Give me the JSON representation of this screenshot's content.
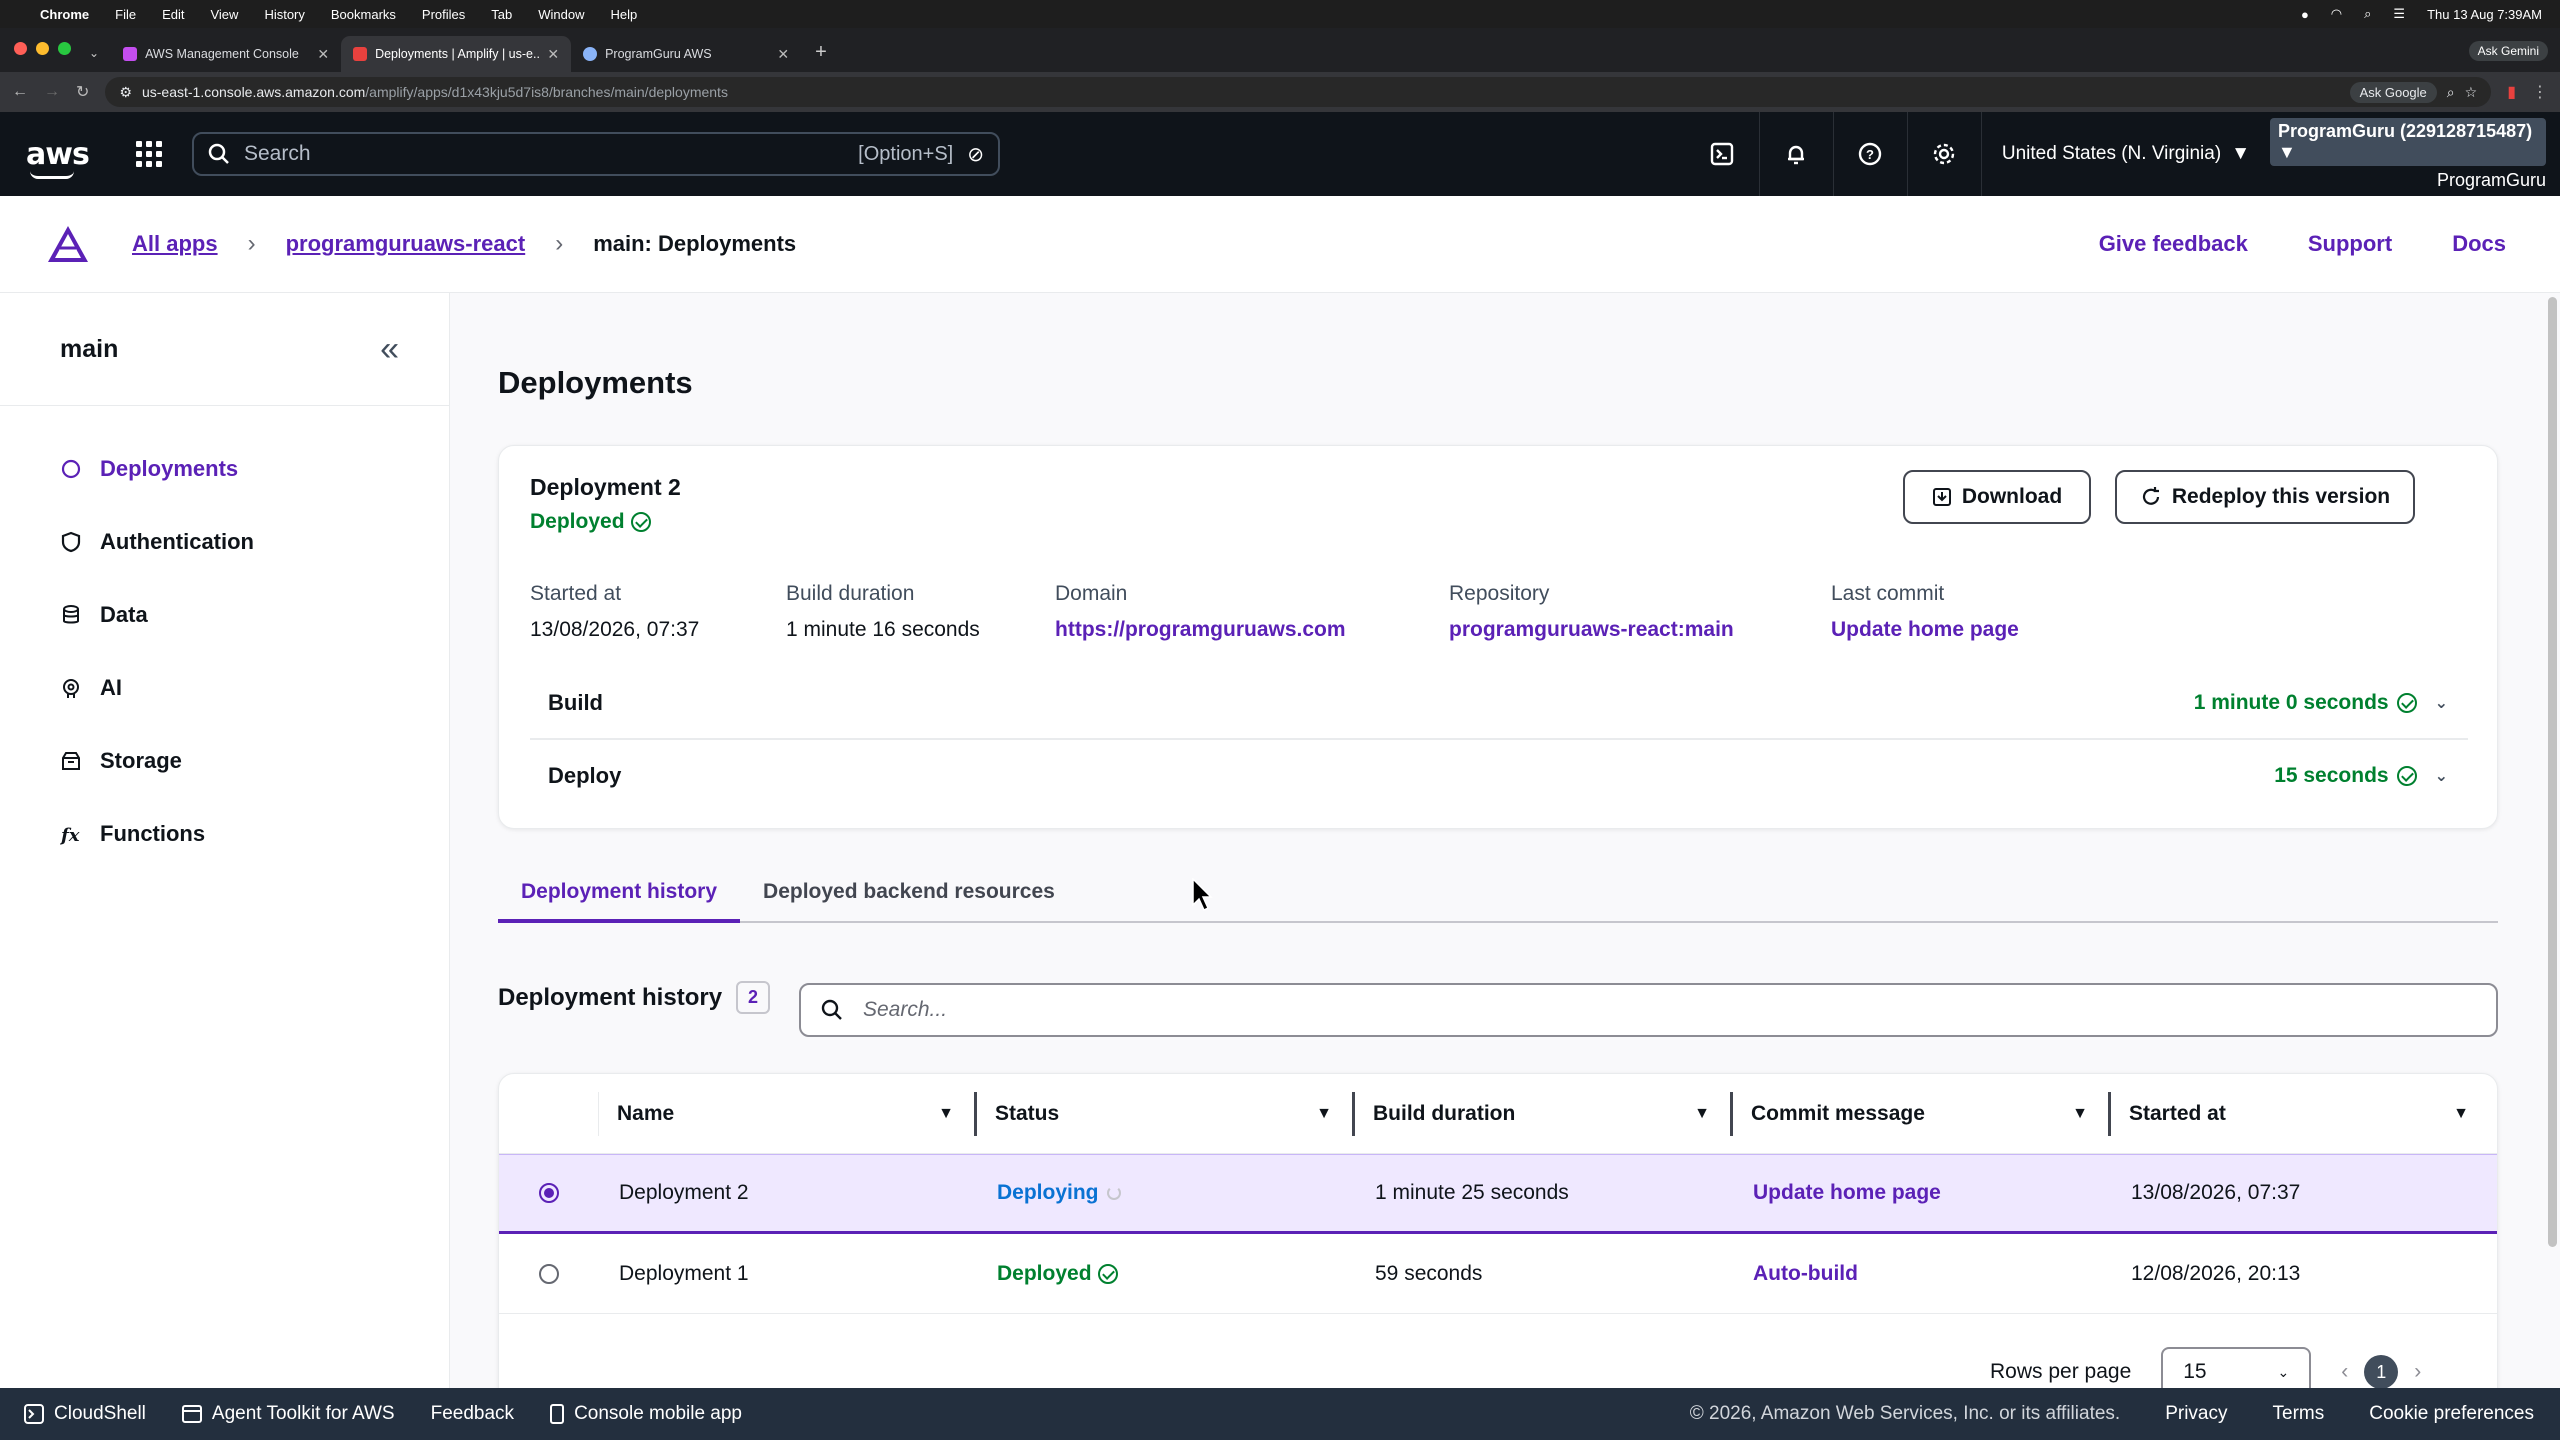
{
  "mac": {
    "app": "Chrome",
    "menus": [
      "File",
      "Edit",
      "View",
      "History",
      "Bookmarks",
      "Profiles",
      "Tab",
      "Window",
      "Help"
    ],
    "datetime": "Thu 13 Aug 7:39AM",
    "ask_gemini": "Ask Gemini"
  },
  "browser": {
    "tabs": [
      {
        "title": "AWS Management Console",
        "active": false
      },
      {
        "title": "Deployments | Amplify | us-e...",
        "active": true
      },
      {
        "title": "ProgramGuru AWS",
        "active": false
      }
    ],
    "url": "us-east-1.console.aws.amazon.com",
    "url_path": "/amplify/apps/d1x43kju5d7is8/branches/main/deployments",
    "ask_google": "Ask Google"
  },
  "awsnav": {
    "logo": "aws",
    "search_placeholder": "Search",
    "search_shortcut": "[Option+S]",
    "region": "United States (N. Virginia)",
    "account": "ProgramGuru (229128715487)",
    "user": "ProgramGuru"
  },
  "amplify": {
    "breadcrumbs": [
      "All apps",
      "programguruaws-react",
      "main: Deployments"
    ],
    "header_links": [
      "Give feedback",
      "Support",
      "Docs"
    ]
  },
  "sidebar": {
    "title": "main",
    "items": [
      {
        "label": "Deployments",
        "icon": "circle-icon",
        "active": true
      },
      {
        "label": "Authentication",
        "icon": "shield-icon",
        "active": false
      },
      {
        "label": "Data",
        "icon": "database-icon",
        "active": false
      },
      {
        "label": "AI",
        "icon": "brain-icon",
        "active": false
      },
      {
        "label": "Storage",
        "icon": "storage-icon",
        "active": false
      },
      {
        "label": "Functions",
        "icon": "function-icon",
        "active": false
      }
    ]
  },
  "page": {
    "title": "Deployments"
  },
  "deployment": {
    "name": "Deployment 2",
    "status": "Deployed",
    "download_label": "Download",
    "redeploy_label": "Redeploy this version",
    "meta": [
      {
        "label": "Started at",
        "value": "13/08/2026, 07:37",
        "link": false
      },
      {
        "label": "Build duration",
        "value": "1 minute 16 seconds",
        "link": false
      },
      {
        "label": "Domain",
        "value": "https://programguruaws.com",
        "link": true
      },
      {
        "label": "Repository",
        "value": "programguruaws-react:main",
        "link": true
      },
      {
        "label": "Last commit",
        "value": "Update home page",
        "link": true
      }
    ],
    "phases": [
      {
        "name": "Build",
        "duration": "1 minute 0 seconds"
      },
      {
        "name": "Deploy",
        "duration": "15 seconds"
      }
    ]
  },
  "tabs": [
    "Deployment history",
    "Deployed backend resources"
  ],
  "history": {
    "title": "Deployment history",
    "count": "2",
    "search_placeholder": "Search...",
    "columns": [
      "Name",
      "Status",
      "Build duration",
      "Commit message",
      "Started at"
    ],
    "rows": [
      {
        "name": "Deployment 2",
        "status": "Deploying",
        "duration": "1 minute 25 seconds",
        "commit": "Update home page",
        "started": "13/08/2026, 07:37",
        "selected": true
      },
      {
        "name": "Deployment 1",
        "status": "Deployed",
        "duration": "59 seconds",
        "commit": "Auto-build",
        "started": "12/08/2026, 20:13",
        "selected": false
      }
    ],
    "rows_per_page_label": "Rows per page",
    "rows_per_page": "15",
    "page": "1"
  },
  "footer": {
    "items": [
      "CloudShell",
      "Agent Toolkit for AWS",
      "Feedback",
      "Console mobile app"
    ],
    "copyright": "© 2026, Amazon Web Services, Inc. or its affiliates.",
    "links": [
      "Privacy",
      "Terms",
      "Cookie preferences"
    ]
  },
  "colors": {
    "accent": "#5b21b6",
    "success": "#00802f",
    "info": "#0972d3",
    "nav_bg": "#0f141a",
    "footer_bg": "#232f3e"
  }
}
